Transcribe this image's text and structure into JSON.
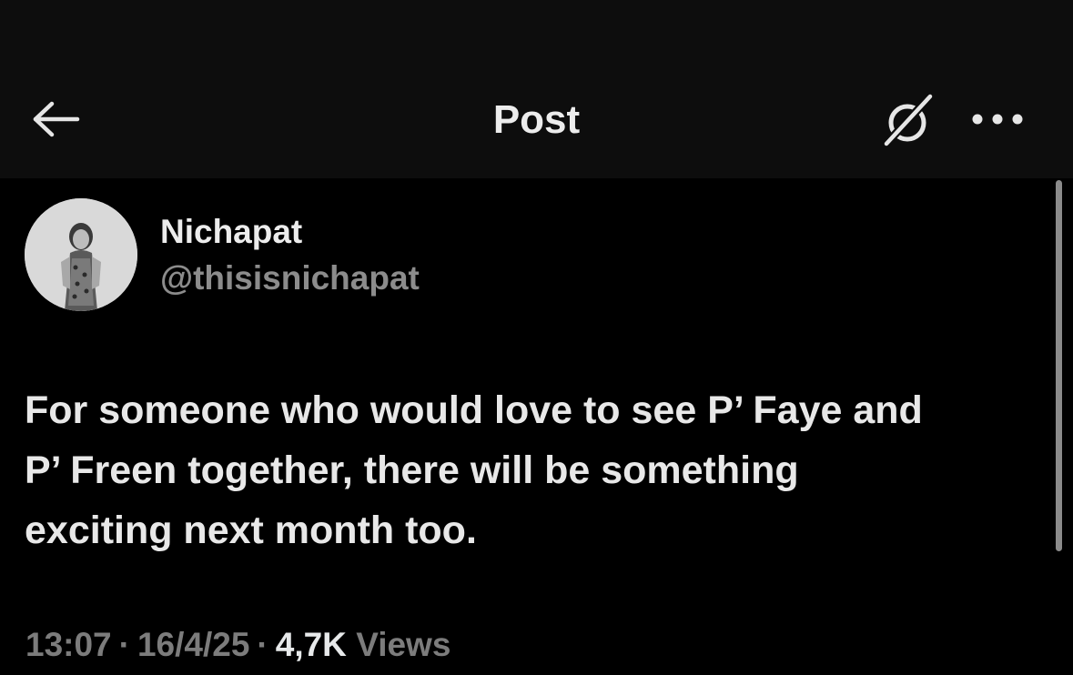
{
  "header": {
    "title": "Post",
    "back_icon": "arrow-left-icon",
    "grok_icon": "grok-icon",
    "more_icon": "more-horizontal-icon"
  },
  "post": {
    "author": {
      "display_name": "Nichapat",
      "handle": "@thisisnichapat"
    },
    "text_lines": [
      "For someone who would love to see P’ Faye and",
      "P’ Freen together, there will be something",
      "exciting next month too."
    ],
    "meta": {
      "time": "13:07",
      "separator": "·",
      "date": "16/4/25",
      "views_count": "4,7K",
      "views_label": "Views"
    }
  },
  "colors": {
    "background": "#000000",
    "header_bg": "#0d0d0d",
    "text_primary": "#e8e8e8",
    "text_secondary": "#7c7c7c"
  }
}
